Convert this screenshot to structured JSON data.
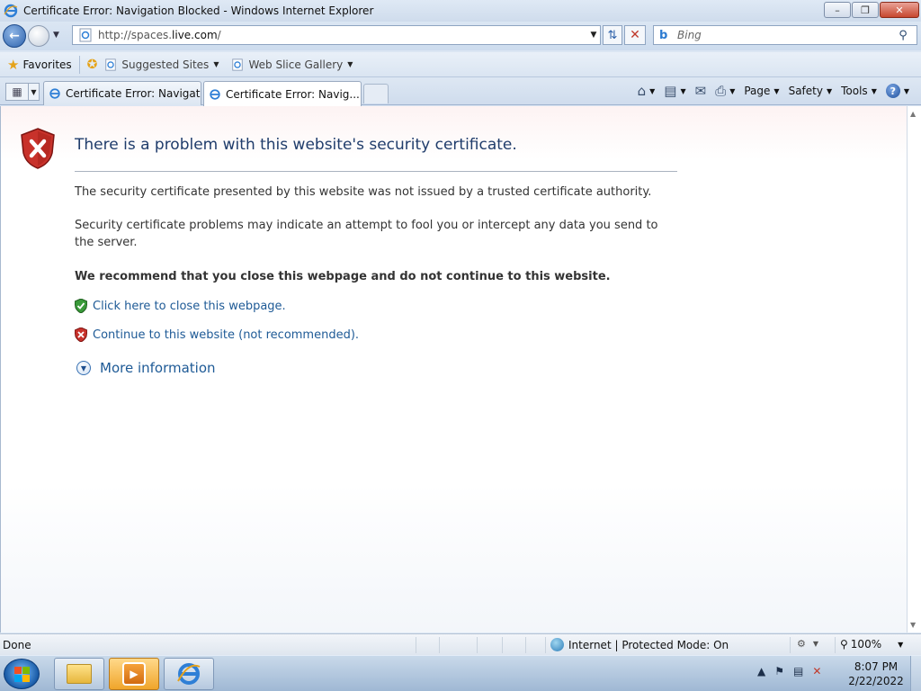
{
  "window": {
    "title": "Certificate Error: Navigation Blocked - Windows Internet Explorer"
  },
  "address_bar": {
    "url_prefix": "http://spaces.",
    "url_domain": "live.com",
    "url_suffix": "/"
  },
  "search": {
    "placeholder": "Bing"
  },
  "favorites_bar": {
    "favorites_label": "Favorites",
    "suggested_sites": "Suggested Sites",
    "web_slice_gallery": "Web Slice Gallery"
  },
  "tabs": [
    {
      "label": "Certificate Error: Navigatio..."
    },
    {
      "label": "Certificate Error: Navig..."
    }
  ],
  "command_bar": {
    "page": "Page",
    "safety": "Safety",
    "tools": "Tools"
  },
  "content": {
    "title": "There is a problem with this website's security certificate.",
    "para1": "The security certificate presented by this website was not issued by a trusted certificate authority.",
    "para2": "Security certificate problems may indicate an attempt to fool you or intercept any data you send to the server.",
    "recommendation": "We recommend that you close this webpage and do not continue to this website.",
    "close_link": "Click here to close this webpage.",
    "continue_link": "Continue to this website (not recommended).",
    "more_info": "More information"
  },
  "status_bar": {
    "status": "Done",
    "zone": "Internet | Protected Mode: On",
    "zoom": "100%"
  },
  "taskbar": {
    "time": "8:07 PM",
    "date": "2/22/2022"
  },
  "colors": {
    "link": "#1e5a96",
    "title": "#1f3c6b",
    "error_red": "#c0392b"
  }
}
